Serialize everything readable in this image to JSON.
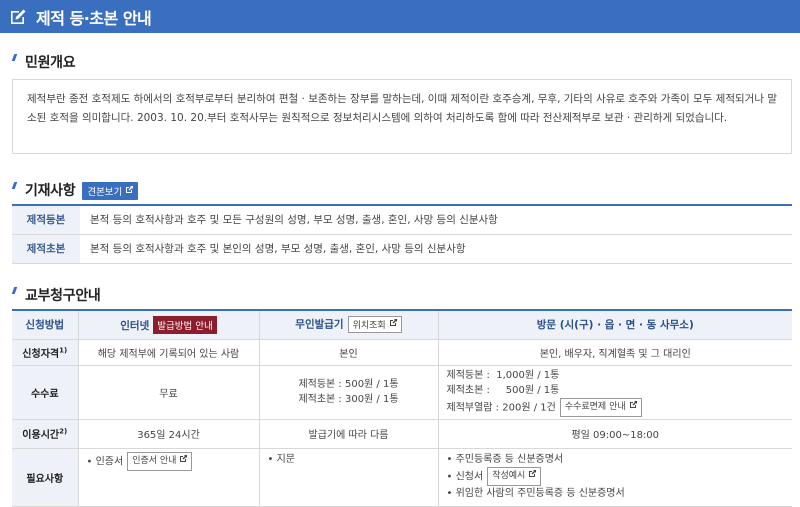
{
  "header": {
    "title": "제적 등·초본 안내",
    "icon": "edit-icon"
  },
  "overview": {
    "title": "민원개요",
    "text": "제적부란 종전 호적제도 하에서의 호적부로부터 분리하여 편철 · 보존하는 장부를 말하는데, 이때 제적이란 호주승계, 무후, 기타의 사유로 호주와 가족이 모두 제적되거나 말소된 호적을 의미합니다. 2003. 10. 20.부터 호적사무는 원칙적으로 정보처리시스템에 의하여 처리하도록 함에 따라 전산제적부로 보관 · 관리하게 되었습니다."
  },
  "entries": {
    "title": "기재사항",
    "sample_button": "견본보기",
    "rows": [
      {
        "label": "제적등본",
        "value": "본적 등의 호적사항과 호주 및 모든 구성원의 성명, 부모 성명, 출생, 혼인, 사망 등의 신분사항"
      },
      {
        "label": "제적초본",
        "value": "본적 등의 호적사항과 호주 및 본인의 성명, 부모 성명, 출생, 혼인, 사망 등의 신분사항"
      }
    ]
  },
  "issuance": {
    "title": "교부청구안내",
    "headers": {
      "method": "신청방법",
      "internet": "인터넷",
      "internet_badge": "발급방법 안내",
      "kiosk": "무인발급기",
      "kiosk_button": "위치조회",
      "visit": "방문 (시(구) · 읍 · 면 · 동 사무소)"
    },
    "rows": {
      "eligibility": {
        "label": "신청자격",
        "sup": "1)",
        "internet": "해당 제적부에 기록되어 있는 사람",
        "kiosk": "본인",
        "visit": "본인, 배우자, 직계혈족 및 그 대리인"
      },
      "fee": {
        "label": "수수료",
        "internet": "무료",
        "kiosk_1": "제적등본 : 500원 / 1통",
        "kiosk_2": "제적초본 : 300원 / 1통",
        "visit_1": "제적등본 :  1,000원 / 1통",
        "visit_2": "제적초본 :     500원 / 1통",
        "visit_3": "제적부열람 :  200원 / 1건",
        "visit_button": "수수료면제 안내"
      },
      "hours": {
        "label": "이용시간",
        "sup": "2)",
        "internet": "365일 24시간",
        "kiosk": "발급기에 따라 다름",
        "visit": "평일 09:00~18:00"
      },
      "required": {
        "label": "필요사항",
        "internet": "인증서",
        "internet_button": "인증서 안내",
        "kiosk": "지문",
        "visit_1": "주민등록증 등 신분증명서",
        "visit_2": "신청서",
        "visit_2_button": "작성예시",
        "visit_3": "위임한 사람의 주민등록증 등 신분증명서"
      }
    }
  }
}
